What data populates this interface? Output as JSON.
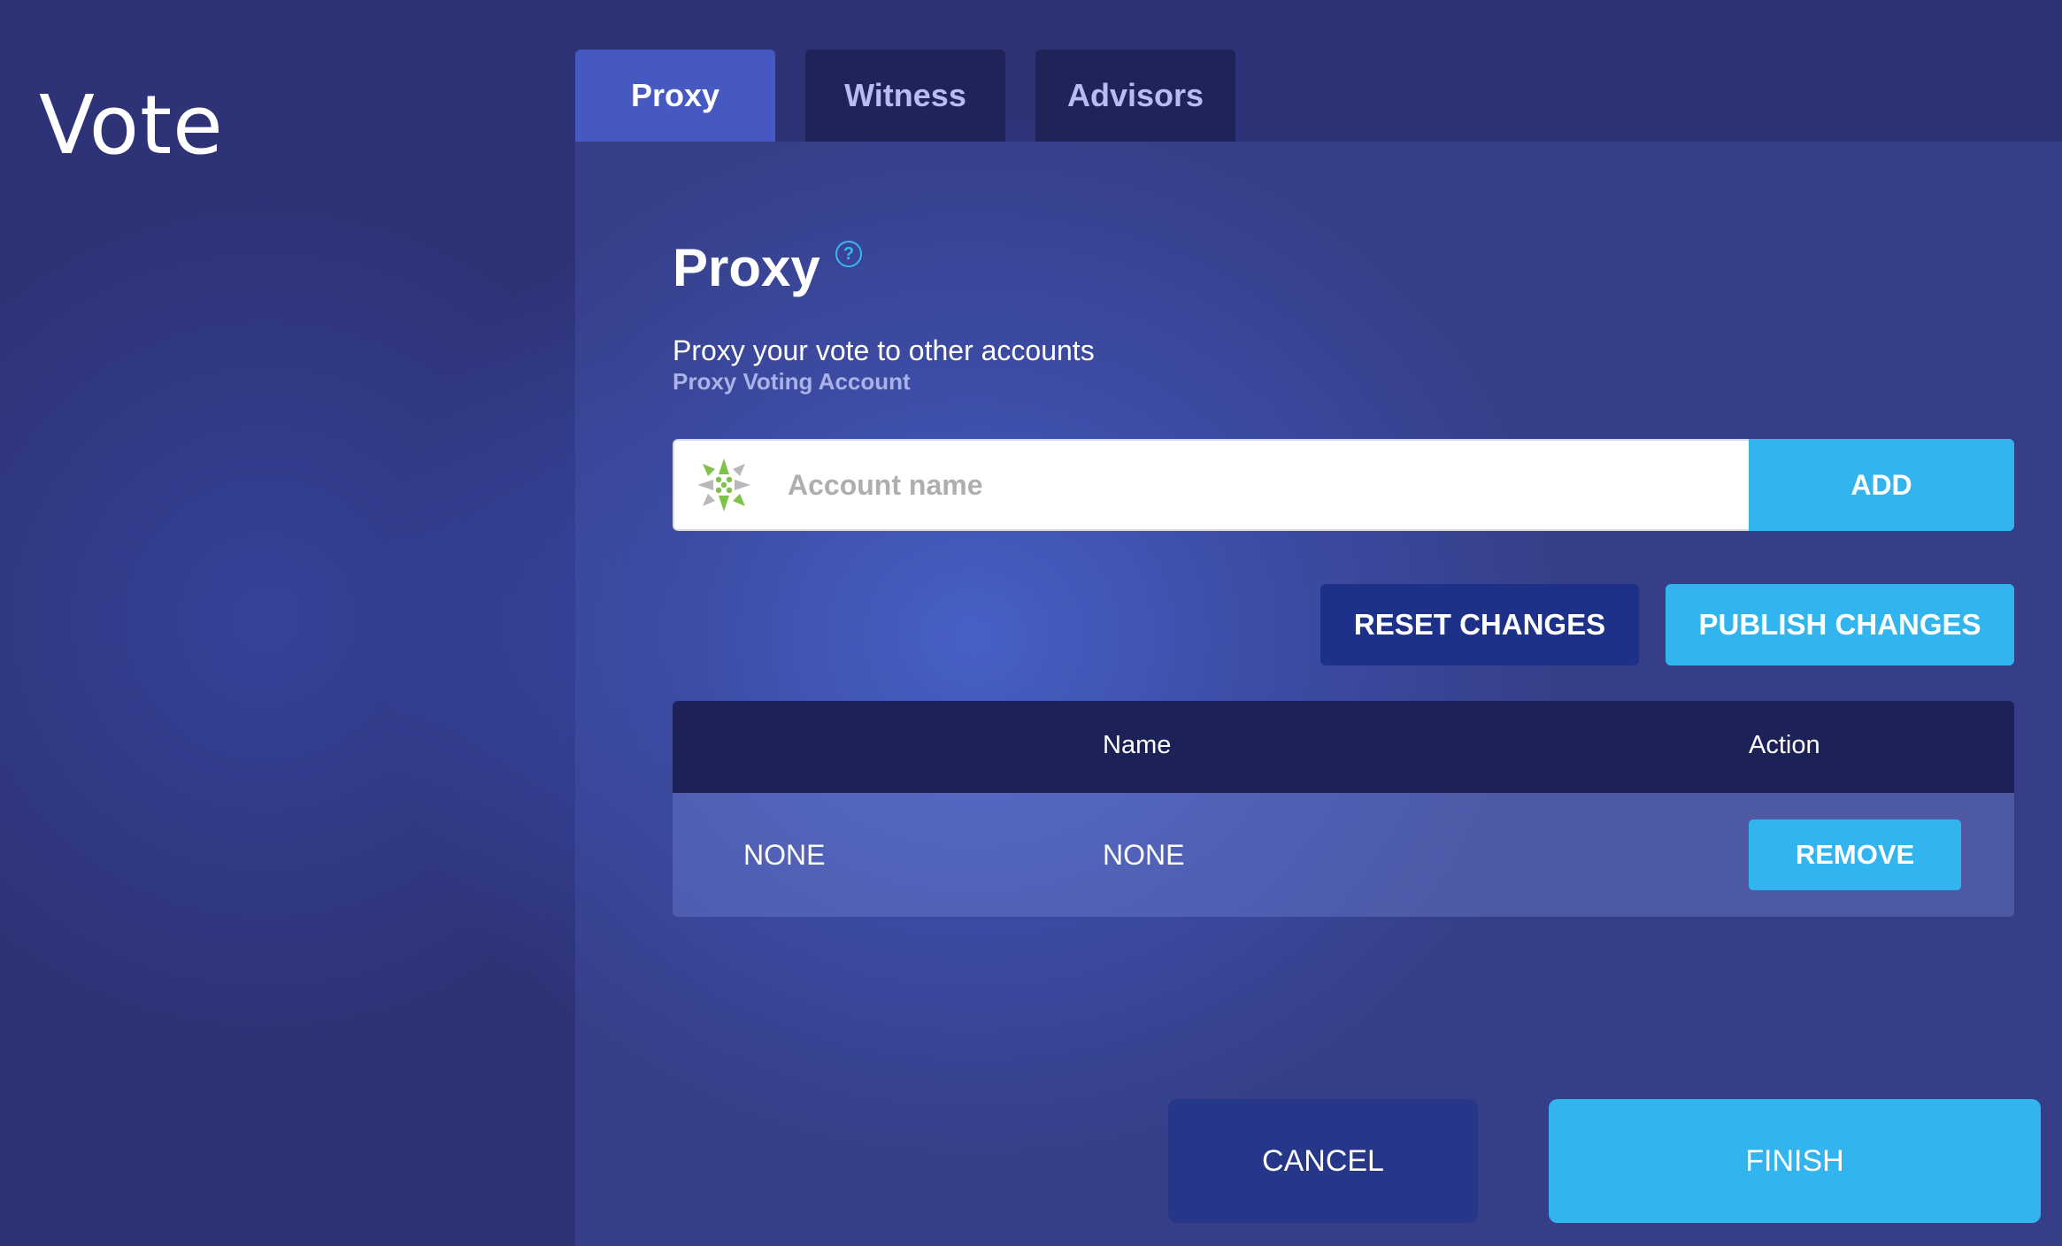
{
  "page": {
    "title": "Vote"
  },
  "tabs": [
    {
      "label": "Proxy",
      "active": true
    },
    {
      "label": "Witness",
      "active": false
    },
    {
      "label": "Advisors",
      "active": false
    }
  ],
  "section": {
    "title": "Proxy",
    "help_icon": "question-circle-icon",
    "subtitle": "Proxy your vote to other accounts",
    "sub_label": "Proxy Voting Account"
  },
  "account_input": {
    "placeholder": "Account name",
    "value": "",
    "add_label": "ADD"
  },
  "actions": {
    "reset_label": "RESET CHANGES",
    "publish_label": "PUBLISH CHANGES"
  },
  "table": {
    "headers": {
      "id": "",
      "name": "Name",
      "action": "Action"
    },
    "rows": [
      {
        "id": "NONE",
        "name": "NONE",
        "action_label": "REMOVE"
      }
    ]
  },
  "footer": {
    "cancel_label": "CANCEL",
    "finish_label": "FINISH"
  },
  "colors": {
    "accent": "#32b4ef",
    "dark_button": "#1c3187",
    "tab_active": "#4659c1",
    "tab_inactive": "#1e2458",
    "table_header": "#1c2158"
  }
}
